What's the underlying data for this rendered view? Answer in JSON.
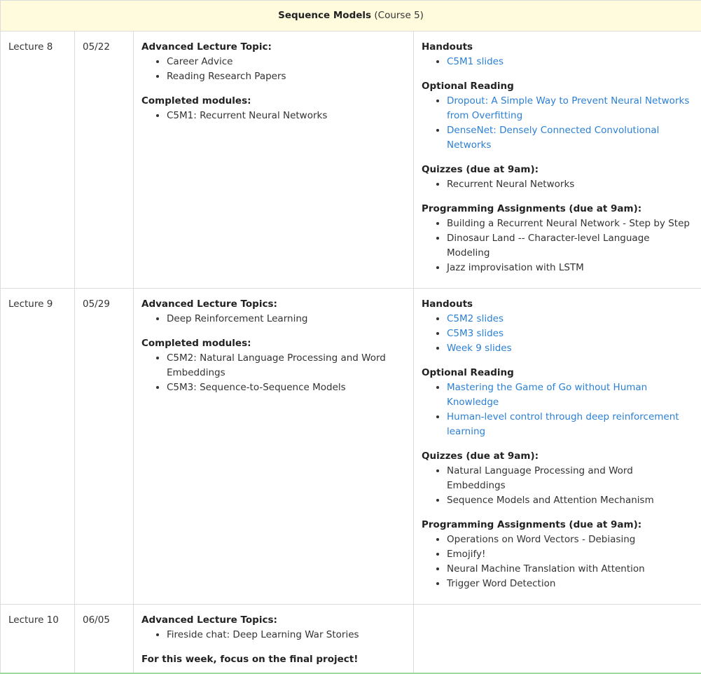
{
  "course": {
    "title": "Sequence Models",
    "number": "(Course 5)"
  },
  "rows": [
    {
      "lecture": "Lecture 8",
      "date": "05/22",
      "topics_head": "Advanced Lecture Topic:",
      "topics": [
        "Career Advice",
        "Reading Research Papers"
      ],
      "modules_head": "Completed modules:",
      "modules": [
        "C5M1: Recurrent Neural Networks"
      ],
      "handouts_head": "Handouts",
      "handouts": [
        "C5M1 slides"
      ],
      "reading_head": "Optional Reading",
      "reading": [
        "Dropout: A Simple Way to Prevent Neural Networks from Overfitting",
        "DenseNet: Densely Connected Convolutional Networks"
      ],
      "quizzes_head": "Quizzes (due at 9am):",
      "quizzes": [
        "Recurrent Neural Networks"
      ],
      "assignments_head": "Programming Assignments (due at 9am):",
      "assignments": [
        "Building a Recurrent Neural Network - Step by Step",
        "Dinosaur Land -- Character-level Language Modeling",
        "Jazz improvisation with LSTM"
      ]
    },
    {
      "lecture": "Lecture 9",
      "date": "05/29",
      "topics_head": "Advanced Lecture Topics:",
      "topics": [
        "Deep Reinforcement Learning"
      ],
      "modules_head": "Completed modules:",
      "modules": [
        "C5M2: Natural Language Processing and Word Embeddings",
        "C5M3: Sequence-to-Sequence Models"
      ],
      "handouts_head": "Handouts",
      "handouts": [
        "C5M2 slides",
        "C5M3 slides",
        "Week 9 slides"
      ],
      "reading_head": "Optional Reading",
      "reading": [
        "Mastering the Game of Go without Human Knowledge",
        "Human-level control through deep reinforcement learning"
      ],
      "quizzes_head": "Quizzes (due at 9am):",
      "quizzes": [
        "Natural Language Processing and Word Embeddings",
        "Sequence Models and Attention Mechanism"
      ],
      "assignments_head": "Programming Assignments (due at 9am):",
      "assignments": [
        "Operations on Word Vectors - Debiasing",
        "Emojify!",
        "Neural Machine Translation with Attention",
        "Trigger Word Detection"
      ]
    },
    {
      "lecture": "Lecture 10",
      "date": "06/05",
      "topics_head": "Advanced Lecture Topics:",
      "topics": [
        "Fireside chat: Deep Learning War Stories"
      ],
      "focus_note": "For this week, focus on the final project!"
    }
  ],
  "colors": {
    "header_bg": "#fffbdc",
    "link": "#2b80d6",
    "border": "#dcdcdc",
    "bottom_accent": "#9ed99e"
  }
}
